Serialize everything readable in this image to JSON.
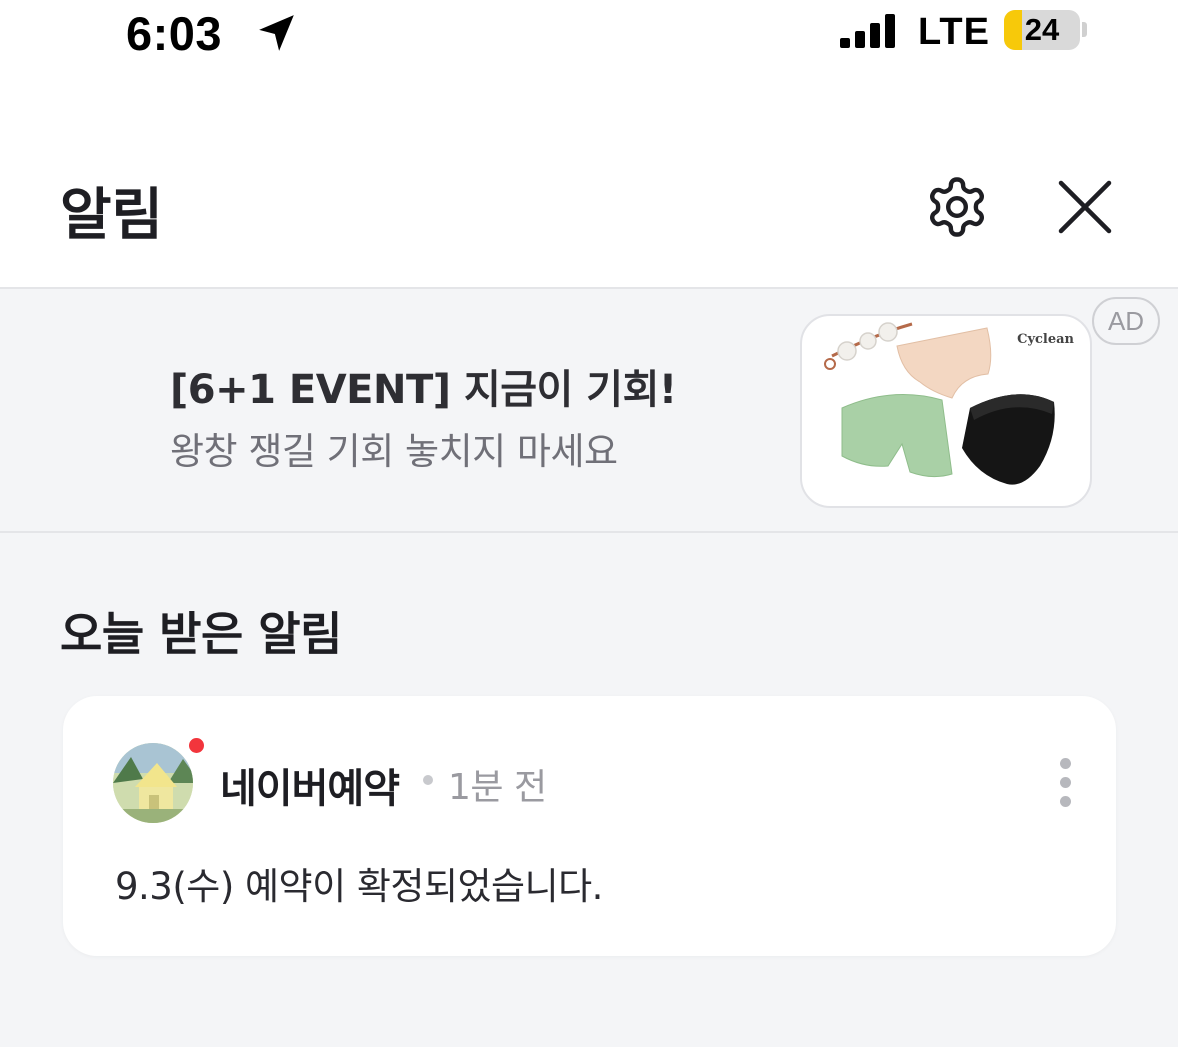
{
  "status_bar": {
    "time": "6:03",
    "network": "LTE",
    "battery_level": "24",
    "battery_fraction": 0.24,
    "battery_color": "#f7c90a",
    "location_icon": "location-arrow-icon",
    "signal_icon": "cellular-signal-icon"
  },
  "header": {
    "title": "알림",
    "settings_icon": "gear-icon",
    "close_icon": "close-icon"
  },
  "ad": {
    "title": "[6+1 EVENT] 지금이 기회!",
    "subtitle": "왕창 쟁길 기회 놓치지 마세요",
    "brand": "Cyclean",
    "badge": "AD"
  },
  "section": {
    "title": "오늘 받은 알림"
  },
  "notification": {
    "sender": "네이버예약",
    "time": "1분 전",
    "message": "9.3(수) 예약이 확정되었습니다.",
    "unread": true,
    "unread_color": "#f2353c",
    "more_icon": "more-vertical-icon"
  }
}
